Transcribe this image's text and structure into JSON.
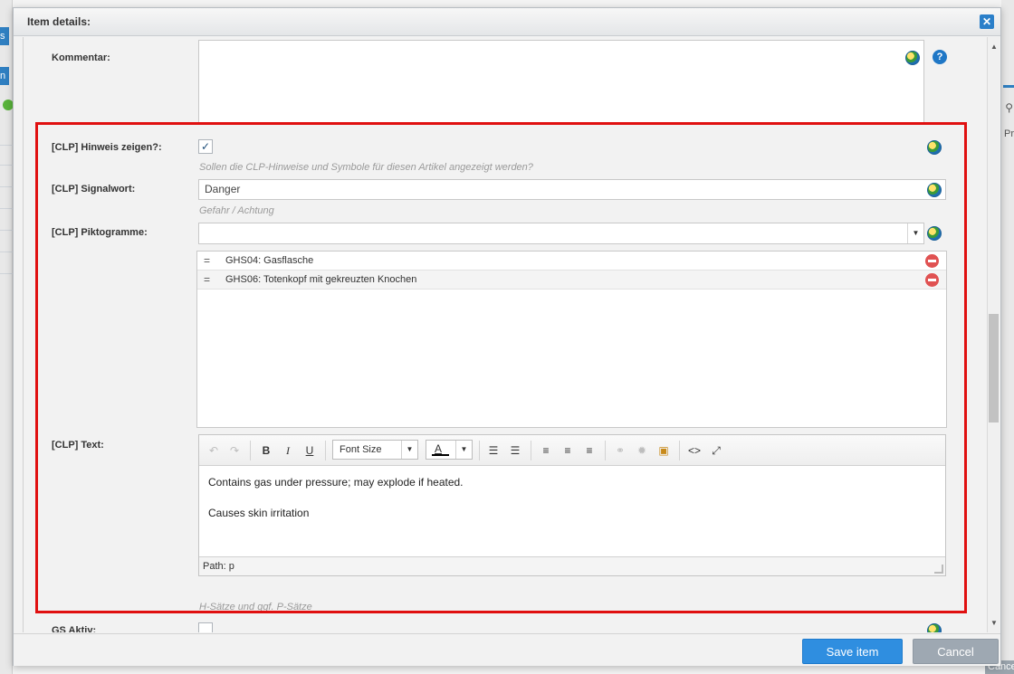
{
  "background": {
    "left_tab_1": "s",
    "left_tab_2": "n",
    "right_text": "Pr",
    "right_cancel": "Cance"
  },
  "dialog": {
    "title": "Item details:",
    "close_glyph": "✕"
  },
  "form": {
    "kommentar_label": "Kommentar:",
    "help_glyph": "?",
    "clp_hint_label": "[CLP] Hinweis zeigen?:",
    "clp_hint_checked_glyph": "✓",
    "clp_hint_help": "Sollen die CLP-Hinweise und Symbole für diesen Artikel angezeigt werden?",
    "signalwort_label": "[CLP] Signalwort:",
    "signalwort_value": "Danger",
    "signalwort_help": "Gefahr / Achtung",
    "piktogramme_label": "[CLP] Piktogramme:",
    "piktogramme_value": "",
    "piktogramme_items": [
      {
        "label": "GHS04: Gasflasche"
      },
      {
        "label": "GHS06: Totenkopf mit gekreuzten Knochen"
      }
    ],
    "clp_text_label": "[CLP] Text:",
    "clp_text_help": "H-Sätze und ggf. P-Sätze",
    "gs_aktiv_label": "GS Aktiv:"
  },
  "editor": {
    "font_size_label": "Font Size",
    "color_letter": "A",
    "bold": "B",
    "italic": "I",
    "underline": "U",
    "paragraphs": [
      "Contains gas under pressure; may explode if heated.",
      "Causes skin irritation"
    ],
    "path": "Path: p"
  },
  "footer": {
    "save_label": "Save item",
    "cancel_label": "Cancel"
  },
  "colors": {
    "highlight": "#e01010",
    "primary_button": "#2f8ee0",
    "secondary_button": "#9ea8b2"
  }
}
